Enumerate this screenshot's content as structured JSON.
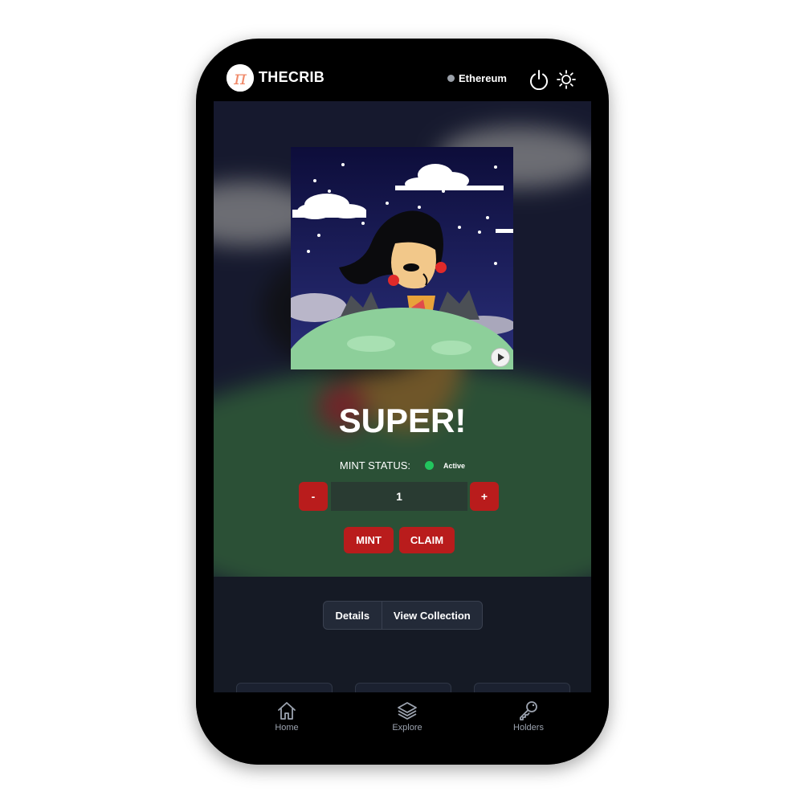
{
  "header": {
    "brand": "THECRIB",
    "logo_symbol": "π",
    "network": "Ethereum",
    "icons": [
      "power-icon",
      "sun-icon"
    ]
  },
  "hero": {
    "title": "SUPER!",
    "mint_status_label": "MINT STATUS:",
    "mint_status_value": "Active",
    "status_color": "#22c55e",
    "quantity": "1",
    "decrement_label": "-",
    "increment_label": "+",
    "mint_label": "MINT",
    "claim_label": "CLAIM",
    "accent_color": "#b91c1c"
  },
  "tabs": [
    {
      "label": "Details"
    },
    {
      "label": "View Collection"
    }
  ],
  "bottom_nav": [
    {
      "label": "Home",
      "icon": "home-icon"
    },
    {
      "label": "Explore",
      "icon": "layers-icon"
    },
    {
      "label": "Holders",
      "icon": "key-icon"
    }
  ]
}
